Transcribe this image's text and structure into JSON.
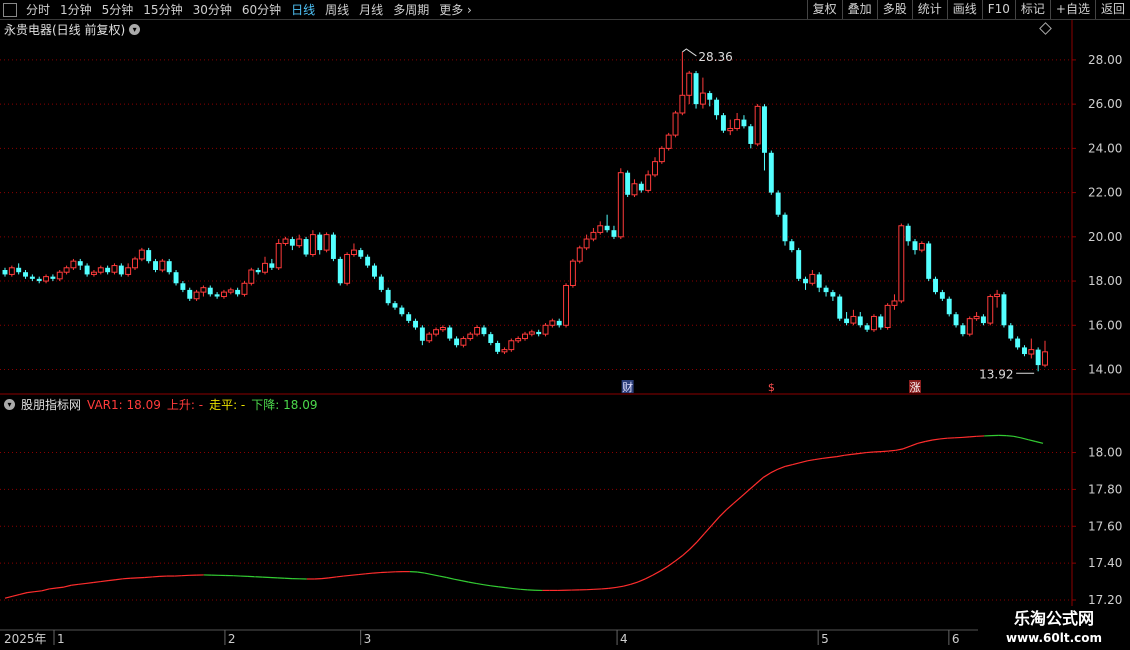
{
  "toolbar": {
    "periods": [
      "分时",
      "1分钟",
      "5分钟",
      "15分钟",
      "30分钟",
      "60分钟",
      "日线",
      "周线",
      "月线",
      "多周期",
      "更多"
    ],
    "active_period": "日线",
    "right_buttons": [
      "复权",
      "叠加",
      "多股",
      "统计",
      "画线",
      "F10",
      "标记",
      "+自选",
      "返回"
    ]
  },
  "chart_title": "永贵电器(日线 前复权)",
  "indicator": {
    "name": "股朋指标网",
    "var1": "VAR1: 18.09",
    "up": "上升: -",
    "flat": "走平: -",
    "down": "下降: 18.09"
  },
  "annotations": {
    "high_label": "28.36",
    "low_label": "13.92"
  },
  "markers": [
    "财",
    "$",
    "涨"
  ],
  "date_axis": {
    "year": "2025年",
    "months": [
      "1",
      "2",
      "3",
      "4",
      "5",
      "6"
    ]
  },
  "watermark": {
    "line1": "乐淘公式网",
    "line2": "www.60lt.com"
  },
  "colors": {
    "up": "#ff3b3b",
    "down": "#54ffff",
    "flat": "#e8e000",
    "indicator_up": "#ff2d2d",
    "indicator_down": "#33cc33",
    "grid": "#8b0000"
  },
  "chart_data": [
    {
      "type": "candlestick",
      "title": "永贵电器(日线 前复权)",
      "ylim": [
        13.3,
        28.9
      ],
      "yticks": [
        "28.00",
        "26.00",
        "24.00",
        "22.00",
        "20.00",
        "18.00",
        "16.00",
        "14.00"
      ],
      "candles": [
        [
          18.5,
          18.3,
          18.6,
          18.2
        ],
        [
          18.3,
          18.6,
          18.7,
          18.2
        ],
        [
          18.6,
          18.4,
          18.8,
          18.3
        ],
        [
          18.4,
          18.2,
          18.5,
          18.1
        ],
        [
          18.2,
          18.1,
          18.3,
          18.0
        ],
        [
          18.1,
          18.0,
          18.2,
          17.9
        ],
        [
          18.0,
          18.2,
          18.3,
          17.9
        ],
        [
          18.2,
          18.1,
          18.3,
          18.0
        ],
        [
          18.1,
          18.4,
          18.5,
          18.0
        ],
        [
          18.4,
          18.6,
          18.7,
          18.3
        ],
        [
          18.6,
          18.9,
          19.0,
          18.5
        ],
        [
          18.9,
          18.7,
          19.0,
          18.5
        ],
        [
          18.7,
          18.3,
          18.8,
          18.2
        ],
        [
          18.3,
          18.4,
          18.5,
          18.2
        ],
        [
          18.4,
          18.6,
          18.7,
          18.3
        ],
        [
          18.6,
          18.4,
          18.7,
          18.3
        ],
        [
          18.4,
          18.7,
          18.8,
          18.3
        ],
        [
          18.7,
          18.3,
          18.8,
          18.2
        ],
        [
          18.3,
          18.6,
          18.8,
          18.2
        ],
        [
          18.6,
          19.0,
          19.1,
          18.5
        ],
        [
          19.0,
          19.4,
          19.5,
          18.9
        ],
        [
          19.4,
          18.9,
          19.5,
          18.8
        ],
        [
          18.9,
          18.5,
          19.0,
          18.4
        ],
        [
          18.5,
          18.9,
          19.0,
          18.4
        ],
        [
          18.9,
          18.4,
          19.0,
          18.3
        ],
        [
          18.4,
          17.9,
          18.5,
          17.8
        ],
        [
          17.9,
          17.6,
          18.0,
          17.5
        ],
        [
          17.6,
          17.2,
          17.7,
          17.1
        ],
        [
          17.2,
          17.5,
          17.6,
          17.1
        ],
        [
          17.5,
          17.7,
          17.8,
          17.3
        ],
        [
          17.7,
          17.4,
          17.8,
          17.3
        ],
        [
          17.4,
          17.3,
          17.5,
          17.2
        ],
        [
          17.3,
          17.5,
          17.6,
          17.2
        ],
        [
          17.5,
          17.6,
          17.7,
          17.4
        ],
        [
          17.6,
          17.4,
          17.7,
          17.3
        ],
        [
          17.4,
          17.9,
          18.0,
          17.3
        ],
        [
          17.9,
          18.5,
          18.6,
          17.8
        ],
        [
          18.5,
          18.4,
          18.6,
          18.3
        ],
        [
          18.4,
          18.8,
          19.1,
          18.3
        ],
        [
          18.8,
          18.6,
          19.0,
          18.5
        ],
        [
          18.6,
          19.7,
          19.9,
          18.5
        ],
        [
          19.7,
          19.9,
          20.0,
          19.6
        ],
        [
          19.9,
          19.6,
          20.0,
          19.4
        ],
        [
          19.6,
          19.9,
          20.1,
          19.5
        ],
        [
          19.9,
          19.2,
          20.0,
          19.1
        ],
        [
          19.2,
          20.1,
          20.3,
          19.1
        ],
        [
          20.1,
          19.4,
          20.2,
          19.2
        ],
        [
          19.4,
          20.1,
          20.2,
          19.3
        ],
        [
          20.1,
          19.0,
          20.2,
          18.9
        ],
        [
          19.0,
          17.9,
          19.1,
          17.8
        ],
        [
          17.9,
          19.2,
          19.3,
          17.8
        ],
        [
          19.2,
          19.4,
          19.7,
          19.1
        ],
        [
          19.4,
          19.1,
          19.5,
          19.0
        ],
        [
          19.1,
          18.7,
          19.2,
          18.6
        ],
        [
          18.7,
          18.2,
          18.8,
          18.1
        ],
        [
          18.2,
          17.6,
          18.3,
          17.5
        ],
        [
          17.6,
          17.0,
          17.7,
          16.9
        ],
        [
          17.0,
          16.8,
          17.1,
          16.7
        ],
        [
          16.8,
          16.5,
          16.9,
          16.4
        ],
        [
          16.5,
          16.2,
          16.6,
          16.1
        ],
        [
          16.2,
          15.9,
          16.3,
          15.8
        ],
        [
          15.9,
          15.3,
          16.0,
          15.1
        ],
        [
          15.3,
          15.6,
          15.7,
          15.2
        ],
        [
          15.6,
          15.8,
          15.9,
          15.5
        ],
        [
          15.8,
          15.9,
          16.0,
          15.7
        ],
        [
          15.9,
          15.4,
          16.0,
          15.3
        ],
        [
          15.4,
          15.1,
          15.5,
          15.0
        ],
        [
          15.1,
          15.4,
          15.5,
          15.0
        ],
        [
          15.4,
          15.6,
          15.7,
          15.3
        ],
        [
          15.6,
          15.9,
          16.0,
          15.5
        ],
        [
          15.9,
          15.6,
          16.0,
          15.5
        ],
        [
          15.6,
          15.2,
          15.7,
          15.1
        ],
        [
          15.2,
          14.8,
          15.3,
          14.7
        ],
        [
          14.8,
          14.9,
          15.0,
          14.7
        ],
        [
          14.9,
          15.3,
          15.4,
          14.8
        ],
        [
          15.3,
          15.4,
          15.5,
          15.2
        ],
        [
          15.4,
          15.6,
          15.7,
          15.3
        ],
        [
          15.6,
          15.7,
          15.8,
          15.5
        ],
        [
          15.7,
          15.6,
          15.8,
          15.5
        ],
        [
          15.6,
          16.0,
          16.1,
          15.5
        ],
        [
          16.0,
          16.2,
          16.3,
          15.9
        ],
        [
          16.2,
          16.0,
          16.3,
          15.9
        ],
        [
          16.0,
          17.8,
          17.9,
          15.9
        ],
        [
          17.8,
          18.9,
          19.0,
          17.7
        ],
        [
          18.9,
          19.5,
          19.6,
          18.8
        ],
        [
          19.5,
          19.9,
          20.1,
          19.4
        ],
        [
          19.9,
          20.2,
          20.4,
          19.8
        ],
        [
          20.2,
          20.5,
          20.7,
          20.1
        ],
        [
          20.5,
          20.3,
          21.0,
          20.2
        ],
        [
          20.3,
          20.0,
          20.5,
          19.9
        ],
        [
          20.0,
          22.9,
          23.1,
          19.9
        ],
        [
          22.9,
          21.9,
          23.0,
          21.8
        ],
        [
          21.9,
          22.4,
          22.6,
          21.8
        ],
        [
          22.4,
          22.1,
          22.5,
          22.0
        ],
        [
          22.1,
          22.8,
          23.0,
          22.0
        ],
        [
          22.8,
          23.4,
          23.6,
          22.7
        ],
        [
          23.4,
          24.0,
          24.1,
          23.3
        ],
        [
          24.0,
          24.6,
          24.7,
          23.9
        ],
        [
          24.6,
          25.6,
          25.7,
          24.5
        ],
        [
          25.6,
          26.4,
          28.36,
          25.5
        ],
        [
          26.4,
          27.4,
          27.5,
          26.0
        ],
        [
          27.4,
          26.0,
          27.5,
          25.8
        ],
        [
          26.0,
          26.5,
          27.2,
          25.8
        ],
        [
          26.5,
          26.2,
          26.6,
          25.9
        ],
        [
          26.2,
          25.5,
          26.3,
          25.3
        ],
        [
          25.5,
          24.8,
          25.6,
          24.7
        ],
        [
          24.8,
          24.9,
          25.3,
          24.6
        ],
        [
          24.9,
          25.3,
          25.6,
          24.8
        ],
        [
          25.3,
          25.0,
          25.5,
          24.9
        ],
        [
          25.0,
          24.2,
          25.1,
          24.0
        ],
        [
          24.2,
          25.9,
          26.0,
          24.1
        ],
        [
          25.9,
          23.8,
          26.0,
          23.0
        ],
        [
          23.8,
          22.0,
          23.9,
          21.9
        ],
        [
          22.0,
          21.0,
          22.1,
          20.9
        ],
        [
          21.0,
          19.8,
          21.1,
          19.6
        ],
        [
          19.8,
          19.4,
          19.9,
          19.3
        ],
        [
          19.4,
          18.1,
          19.5,
          18.0
        ],
        [
          18.1,
          17.9,
          18.2,
          17.6
        ],
        [
          17.9,
          18.3,
          18.5,
          17.8
        ],
        [
          18.3,
          17.7,
          18.4,
          17.5
        ],
        [
          17.7,
          17.5,
          17.8,
          17.3
        ],
        [
          17.5,
          17.3,
          17.6,
          17.1
        ],
        [
          17.3,
          16.3,
          17.4,
          16.2
        ],
        [
          16.3,
          16.1,
          16.6,
          16.0
        ],
        [
          16.1,
          16.4,
          16.7,
          16.0
        ],
        [
          16.4,
          16.0,
          16.6,
          15.9
        ],
        [
          16.0,
          15.8,
          16.1,
          15.7
        ],
        [
          15.8,
          16.4,
          16.5,
          15.7
        ],
        [
          16.4,
          15.9,
          16.5,
          15.8
        ],
        [
          15.9,
          16.9,
          17.0,
          15.8
        ],
        [
          16.9,
          17.1,
          17.4,
          16.7
        ],
        [
          17.1,
          20.5,
          20.6,
          17.0
        ],
        [
          20.5,
          19.8,
          20.6,
          19.6
        ],
        [
          19.8,
          19.4,
          19.9,
          19.2
        ],
        [
          19.4,
          19.7,
          19.8,
          19.3
        ],
        [
          19.7,
          18.1,
          19.8,
          18.0
        ],
        [
          18.1,
          17.5,
          18.2,
          17.4
        ],
        [
          17.5,
          17.2,
          17.6,
          17.1
        ],
        [
          17.2,
          16.5,
          17.3,
          16.4
        ],
        [
          16.5,
          16.0,
          16.6,
          15.9
        ],
        [
          16.0,
          15.6,
          16.1,
          15.5
        ],
        [
          15.6,
          16.3,
          16.4,
          15.5
        ],
        [
          16.3,
          16.4,
          16.6,
          16.2
        ],
        [
          16.4,
          16.1,
          16.5,
          16.0
        ],
        [
          16.1,
          17.3,
          17.4,
          16.0
        ],
        [
          17.3,
          17.4,
          17.6,
          16.8
        ],
        [
          17.4,
          16.0,
          17.5,
          15.9
        ],
        [
          16.0,
          15.4,
          16.1,
          15.3
        ],
        [
          15.4,
          15.0,
          15.5,
          14.9
        ],
        [
          15.0,
          14.7,
          15.1,
          14.6
        ],
        [
          14.7,
          14.9,
          15.4,
          14.5
        ],
        [
          14.9,
          14.2,
          15.0,
          13.92
        ],
        [
          14.2,
          14.8,
          15.3,
          14.1
        ]
      ]
    },
    {
      "type": "line",
      "title": "股朋指标网",
      "ylim": [
        17.2,
        18.22
      ],
      "yticks": [
        "18.00",
        "17.80",
        "17.60",
        "17.40",
        "17.20"
      ],
      "series": [
        {
          "name": "VAR1",
          "values": [
            17.21,
            17.22,
            17.23,
            17.24,
            17.245,
            17.25,
            17.26,
            17.265,
            17.27,
            17.28,
            17.285,
            17.29,
            17.295,
            17.3,
            17.305,
            17.31,
            17.315,
            17.318,
            17.32,
            17.322,
            17.325,
            17.328,
            17.33,
            17.33,
            17.332,
            17.334,
            17.335,
            17.336,
            17.335,
            17.334,
            17.333,
            17.332,
            17.33,
            17.328,
            17.326,
            17.324,
            17.322,
            17.32,
            17.318,
            17.316,
            17.315,
            17.314,
            17.314,
            17.316,
            17.32,
            17.325,
            17.33,
            17.334,
            17.338,
            17.342,
            17.346,
            17.349,
            17.351,
            17.353,
            17.354,
            17.354,
            17.352,
            17.346,
            17.338,
            17.33,
            17.322,
            17.313,
            17.305,
            17.297,
            17.29,
            17.283,
            17.277,
            17.272,
            17.267,
            17.262,
            17.258,
            17.255,
            17.253,
            17.252,
            17.252,
            17.252,
            17.253,
            17.254,
            17.255,
            17.256,
            17.258,
            17.26,
            17.263,
            17.268,
            17.275,
            17.285,
            17.298,
            17.315,
            17.335,
            17.357,
            17.382,
            17.41,
            17.44,
            17.475,
            17.515,
            17.56,
            17.605,
            17.65,
            17.69,
            17.725,
            17.76,
            17.795,
            17.83,
            17.865,
            17.89,
            17.91,
            17.925,
            17.935,
            17.945,
            17.955,
            17.962,
            17.968,
            17.973,
            17.978,
            17.985,
            17.99,
            17.995,
            18.0,
            18.003,
            18.005,
            18.008,
            18.012,
            18.02,
            18.035,
            18.05,
            18.06,
            18.068,
            18.074,
            18.078,
            18.08,
            18.082,
            18.085,
            18.088,
            18.09,
            18.092,
            18.093,
            18.092,
            18.088,
            18.08,
            18.07,
            18.06,
            18.05
          ],
          "down_from_index": 134
        }
      ]
    }
  ]
}
